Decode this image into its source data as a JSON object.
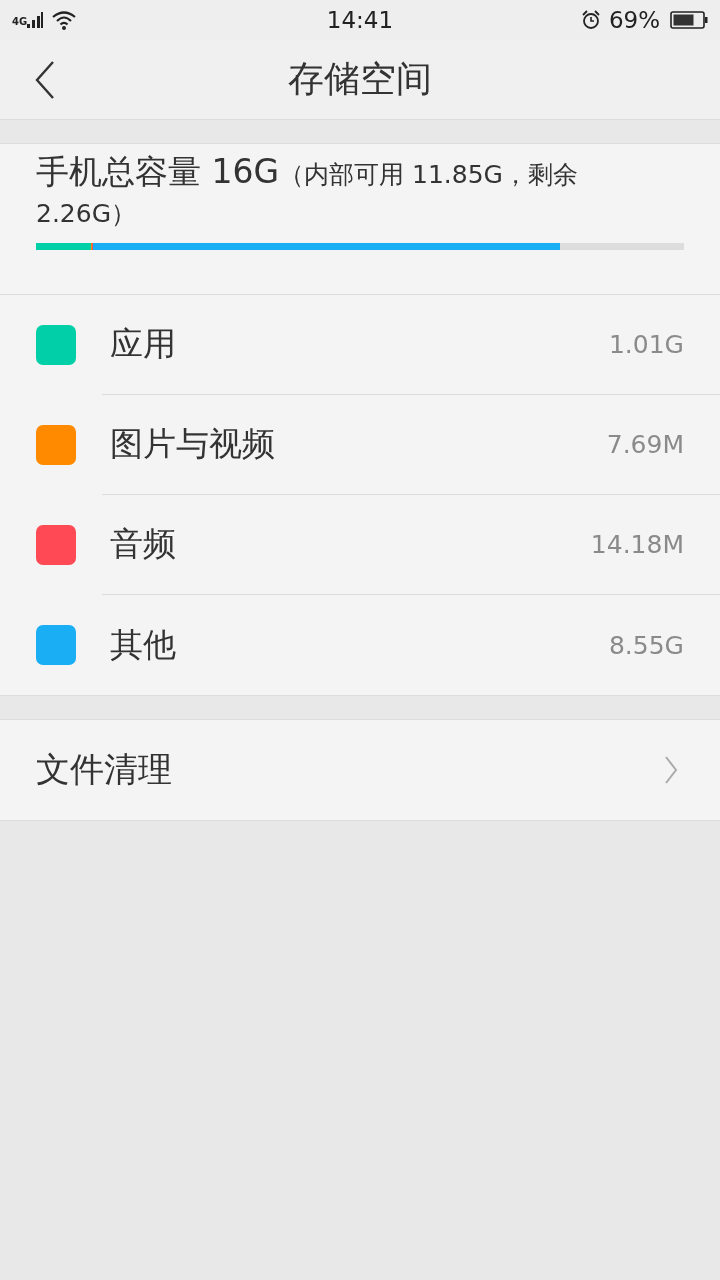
{
  "status_bar": {
    "network": "4G",
    "time": "14:41",
    "battery_percent": "69%"
  },
  "header": {
    "title": "存储空间"
  },
  "summary": {
    "title": "手机总容量 16G",
    "detail": "（内部可用 11.85G，剩余 2.26G）"
  },
  "categories": [
    {
      "name": "应用",
      "size": "1.01G",
      "color": "#00cfa8"
    },
    {
      "name": "图片与视频",
      "size": "7.69M",
      "color": "#ff8a00"
    },
    {
      "name": "音频",
      "size": "14.18M",
      "color": "#ff4a55"
    },
    {
      "name": "其他",
      "size": "8.55G",
      "color": "#1aaff5"
    }
  ],
  "actions": [
    {
      "label": "文件清理"
    }
  ]
}
